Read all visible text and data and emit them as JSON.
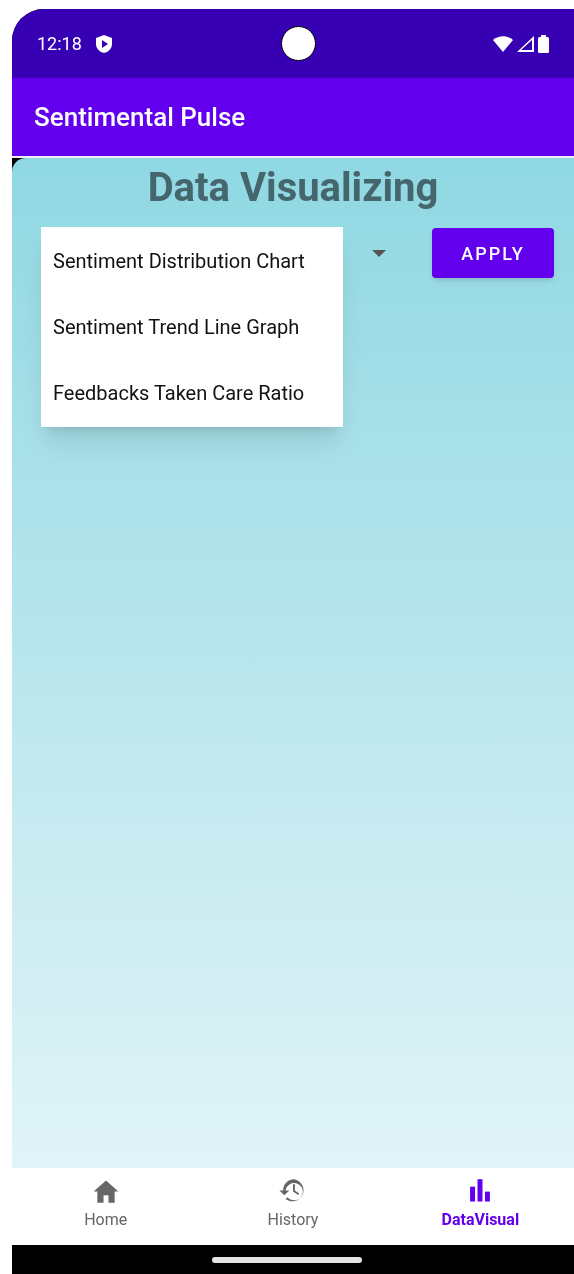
{
  "status_bar": {
    "time": "12:18"
  },
  "app_bar": {
    "title": "Sentimental Pulse"
  },
  "screen": {
    "heading": "Data Visualizing",
    "apply_button": "APPLY",
    "dropdown_menu": [
      {
        "label": "Sentiment Distribution Chart"
      },
      {
        "label": "Sentiment Trend Line Graph"
      },
      {
        "label": "Feedbacks Taken Care Ratio"
      }
    ]
  },
  "bottom_nav": [
    {
      "kind": "home",
      "label": "Home",
      "selected": false
    },
    {
      "kind": "history",
      "label": "History",
      "selected": false
    },
    {
      "kind": "chart",
      "label": "DataVisual",
      "selected": true
    }
  ]
}
